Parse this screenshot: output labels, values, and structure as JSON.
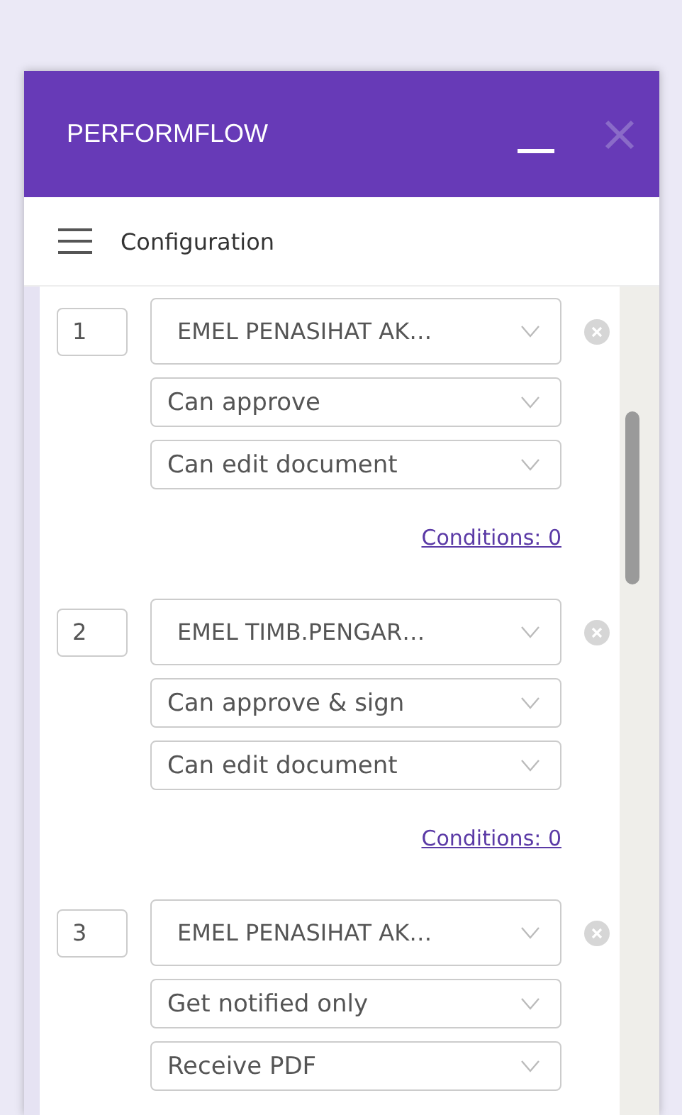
{
  "window": {
    "title": "PERFORMFLOW"
  },
  "toolbar": {
    "title": "Configuration"
  },
  "signers": [
    {
      "order": "1",
      "recipient": "EMEL PENASIHAT AK…",
      "permission": "Can approve",
      "editing": "Can edit document",
      "conditions": "Conditions: 0"
    },
    {
      "order": "2",
      "recipient": "EMEL TIMB.PENGAR…",
      "permission": "Can approve & sign",
      "editing": "Can edit document",
      "conditions": "Conditions: 0"
    },
    {
      "order": "3",
      "recipient": "EMEL PENASIHAT AK…",
      "permission": "Get notified only",
      "editing": "Receive PDF"
    }
  ]
}
